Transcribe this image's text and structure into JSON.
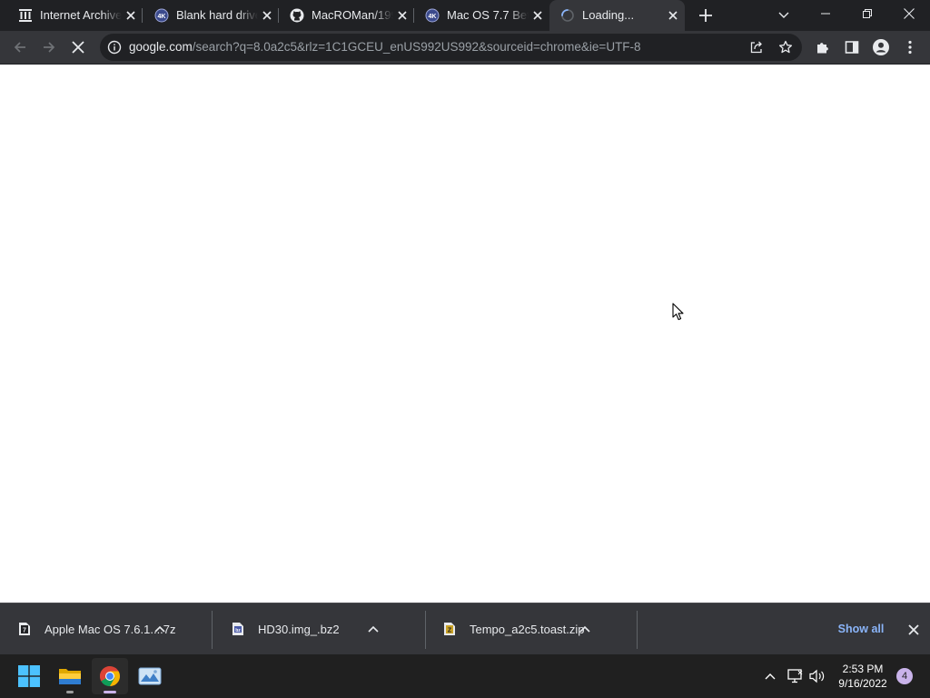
{
  "browser": {
    "tabs": [
      {
        "title": "Internet Archive",
        "icon": "internet-archive-icon"
      },
      {
        "title": "Blank hard drive",
        "icon": "archive-badge-icon"
      },
      {
        "title": "MacROMan/1990",
        "icon": "github-icon"
      },
      {
        "title": "Mac OS 7.7 Beta",
        "icon": "archive-badge-icon"
      },
      {
        "title": "Loading...",
        "icon": "loading-spinner-icon",
        "active": true
      }
    ],
    "address": {
      "host": "google.com",
      "path": "/search?q=8.0a2c5&rlz=1C1GCEU_enUS992US992&sourceid=chrome&ie=UTF-8"
    }
  },
  "downloads": {
    "items": [
      {
        "name": "Apple Mac OS 7.6.1....7z",
        "icon": "7z-file-icon"
      },
      {
        "name": "HD30.img_.bz2",
        "icon": "bz2-file-icon"
      },
      {
        "name": "Tempo_a2c5.toast.zip",
        "icon": "zip-file-icon"
      }
    ],
    "show_all": "Show all"
  },
  "taskbar": {
    "time": "2:53 PM",
    "date": "9/16/2022",
    "notifications": "4"
  },
  "colors": {
    "tabstrip": "#202124",
    "toolbar": "#35363a",
    "omnibox": "#202124",
    "page": "#ffffff",
    "link_accent": "#8ab4f8",
    "taskbar": "#202020",
    "notification_badge": "#c9b3ea"
  }
}
